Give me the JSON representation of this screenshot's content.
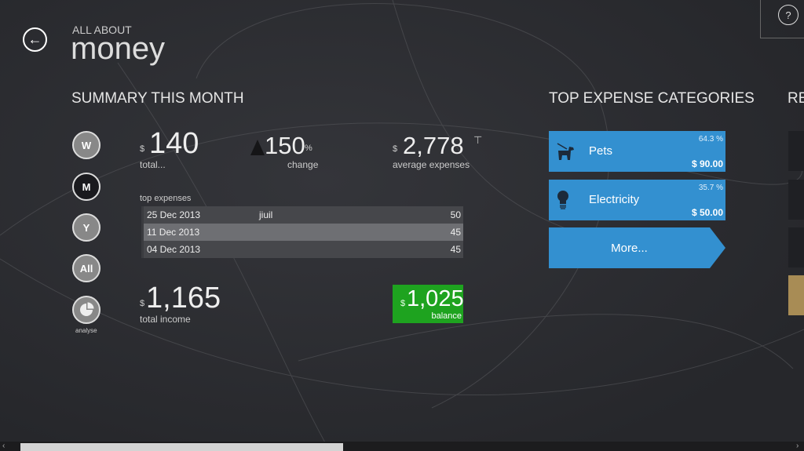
{
  "header": {
    "supertitle": "ALL ABOUT",
    "title": "money",
    "help": "?"
  },
  "summary": {
    "heading": "SUMMARY THIS MONTH",
    "periods": [
      "W",
      "M",
      "Y",
      "All"
    ],
    "analyse_label": "analyse",
    "currency": "$",
    "total": {
      "value": "140",
      "label": "total..."
    },
    "change": {
      "value": "150",
      "unit": "%",
      "label": "change"
    },
    "average": {
      "value": "2,778",
      "label": "average expenses"
    },
    "top_expenses_label": "top expenses",
    "top_expenses": [
      {
        "date": "25 Dec 2013",
        "name": "jiuil",
        "amount": "50"
      },
      {
        "date": "11 Dec 2013",
        "name": "",
        "amount": "45"
      },
      {
        "date": "04 Dec 2013",
        "name": "",
        "amount": "45"
      }
    ],
    "income": {
      "value": "1,165",
      "label": "total income"
    },
    "balance": {
      "value": "1,025",
      "label": "balance"
    }
  },
  "categories": {
    "heading": "TOP EXPENSE CATEGORIES",
    "items": [
      {
        "name": "Pets",
        "percent": "64.3 %",
        "amount": "$ 90.00",
        "icon": "dog-icon"
      },
      {
        "name": "Electricity",
        "percent": "35.7 %",
        "amount": "$ 50.00",
        "icon": "lightbulb-icon"
      }
    ],
    "more": "More..."
  },
  "next_section": {
    "heading_partial": "RE"
  },
  "colors": {
    "accent": "#3390d0",
    "balance": "#1ea31f",
    "gold": "#a88c55"
  }
}
